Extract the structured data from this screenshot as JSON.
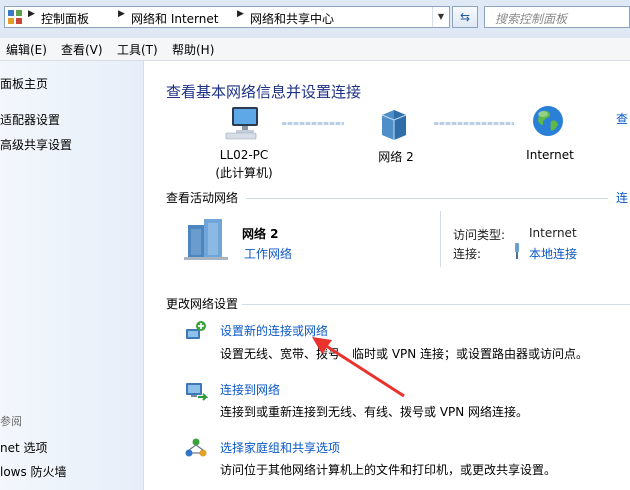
{
  "address": {
    "crumbs": [
      "控制面板",
      "网络和 Internet",
      "网络和共享中心"
    ],
    "search_placeholder": "搜索控制面板"
  },
  "menu": [
    "编辑(E)",
    "查看(V)",
    "工具(T)",
    "帮助(H)"
  ],
  "sidebar": {
    "links": [
      "面板主页",
      "适配器设置",
      "高级共享设置"
    ],
    "see_also_heading": "参阅",
    "see_also": [
      "net 选项",
      "lows 防火墙"
    ]
  },
  "main": {
    "title": "查看基本网络信息并设置连接",
    "map": {
      "computer_label": "LL02-PC",
      "computer_sub": "(此计算机)",
      "network_label": "网络  2",
      "internet_label": "Internet",
      "full_map_link": "查",
      "connect_link": "连"
    },
    "active_section_title": "查看活动网络",
    "active": {
      "name": "网络  2",
      "type_link": "工作网络",
      "access_type_label": "访问类型:",
      "access_type_value": "Internet",
      "connections_label": "连接:",
      "connections_value": "本地连接"
    },
    "change_section_title": "更改网络设置",
    "tasks": [
      {
        "link": "设置新的连接或网络",
        "desc": "设置无线、宽带、拨号、临时或 VPN 连接；或设置路由器或访问点。"
      },
      {
        "link": "连接到网络",
        "desc": "连接到或重新连接到无线、有线、拨号或 VPN 网络连接。"
      },
      {
        "link": "选择家庭组和共享选项",
        "desc": "访问位于其他网络计算机上的文件和打印机，或更改共享设置。"
      }
    ]
  },
  "colors": {
    "link": "#0a58c8",
    "title": "#1e3287",
    "annotation_arrow": "#e8322b"
  }
}
